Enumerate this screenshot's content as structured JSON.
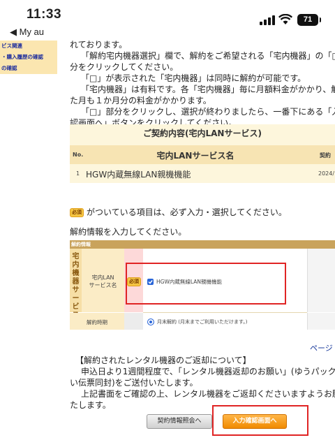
{
  "status_bar": {
    "time": "11:33",
    "back_label": "◀ My au",
    "battery": "71"
  },
  "nav": {
    "items": [
      "ビス関連",
      "・購入履歴の確認",
      "の確認"
    ]
  },
  "intro_lines": [
    "れております。",
    "「解約宅内機器選択」欄で、解約をご希望される「宅内機器」の「□",
    "分をクリックしてください。",
    "「□」が表示された「宅内機器」は同時に解約が可能です。",
    "「宅内機器」は有料です。各「宅内機器」毎に月額料金がかかり、解",
    "た月も１か月分の料金がかかります。",
    "「□」部分をクリックし、選択が終わりましたら、一番下にある「入",
    "認画面へ」ボタンをクリックしてください。"
  ],
  "contract": {
    "title": "ご契約内容(宅内LANサービス)",
    "col_no": "No.",
    "col_name": "宅内LANサービス名",
    "col_extra": "契約",
    "row_no": "1",
    "row_name": "HGW内蔵無線LAN親機機能",
    "row_date": "2024/"
  },
  "required_badge": "必須",
  "required_note": "がついている項目は、必ず入力・選択してください。",
  "input_prompt": "解約情報を入力してください。",
  "form": {
    "bar_label": "解約情報",
    "section_label": "宅内機器サービス",
    "field_label_1": "宅内LAN",
    "field_label_2": "サービス名",
    "checkbox_label": "HGW内蔵無線LAN親機機能",
    "term_label": "解約時期",
    "term_option": "月末解約 (月末までご利用いただけます。)"
  },
  "page_link": "ページ",
  "return_heading": "【解約されたレンタル機器のご返却について】",
  "return_lines": [
    "申込日より1週間程度で、「レンタル機器返却のお願い」(ゆうパック",
    "い伝票同封)をご送付いたします。",
    "上記書面をご確認の上、レンタル機器をご返却くださいますようお願",
    "たします。"
  ],
  "buttons": {
    "info_label": "契約情報照会へ",
    "confirm_label": "入力確認画面へ"
  }
}
